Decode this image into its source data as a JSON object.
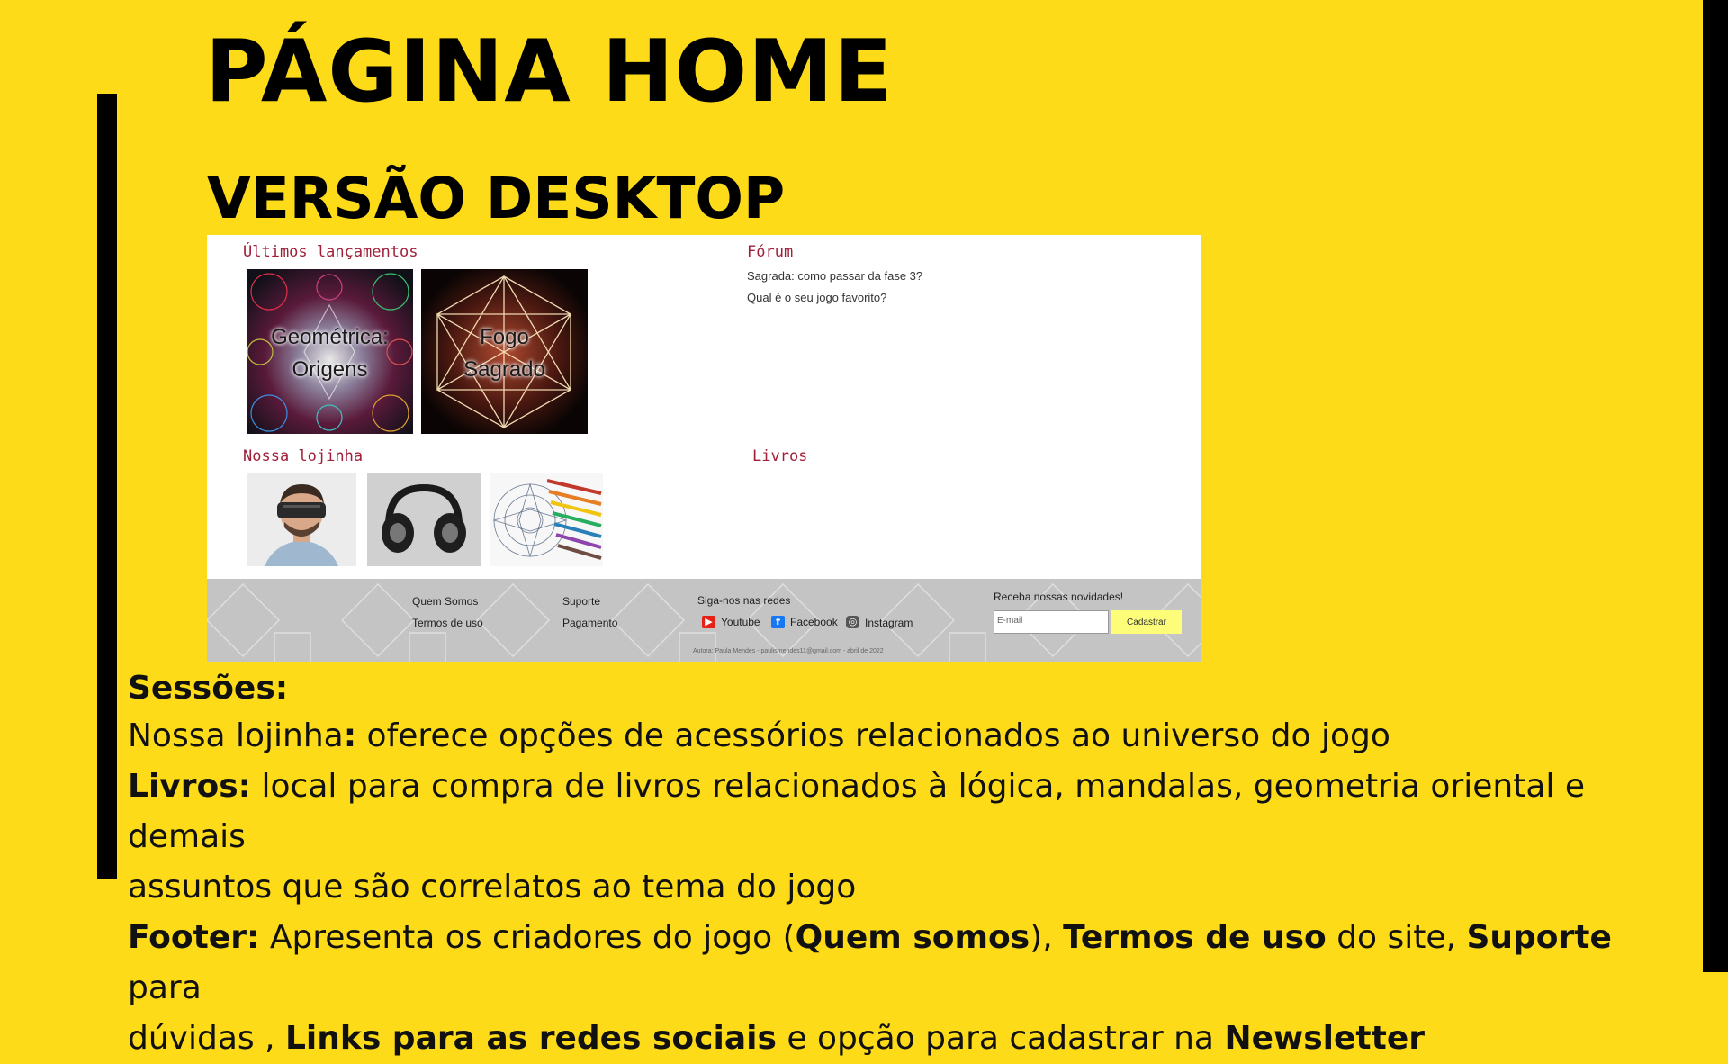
{
  "header": {
    "title": "PÁGINA HOME",
    "subtitle": "VERSÃO DESKTOP"
  },
  "screenshot": {
    "releases": {
      "title": "Últimos lançamentos",
      "games": [
        {
          "name_line1": "Geométrica:",
          "name_line2": "Origens"
        },
        {
          "name_line1": "Fogo",
          "name_line2": "Sagrado"
        }
      ]
    },
    "forum": {
      "title": "Fórum",
      "topics": [
        "Sagrada: como passar da fase 3?",
        "Qual é o seu jogo favorito?"
      ]
    },
    "shop": {
      "title": "Nossa lojinha",
      "products": [
        "vr-headset-photo",
        "headphones-photo",
        "mandala-coloring-photo"
      ]
    },
    "books": {
      "title": "Livros"
    },
    "footer": {
      "links_col1": [
        "Quem Somos",
        "Termos de uso"
      ],
      "links_col2": [
        "Suporte",
        "Pagamento"
      ],
      "social_title": "Siga-nos nas redes",
      "social": [
        "Youtube",
        "Facebook",
        "Instagram"
      ],
      "newsletter_title": "Receba nossas novidades!",
      "email_placeholder": "E-mail",
      "submit_label": "Cadastrar",
      "credit": "Autora: Paula Mendes - paulismendes11@gmail.com - abril de 2022"
    }
  },
  "description": {
    "heading": "Sessões:",
    "shop": {
      "label": "Nossa lojinha",
      "colon": ":",
      "text": " oferece opções de acessórios relacionados ao universo do jogo"
    },
    "books": {
      "label": "Livros:",
      "text": " local para compra de livros relacionados à lógica, mandalas, geometria oriental e demais",
      "text2": "assuntos que são correlatos ao tema do jogo"
    },
    "footer": {
      "label": "Footer:",
      "t1": "  Apresenta os criadores do jogo (",
      "b1": "Quem somos",
      "t2": "), ",
      "b2": "Termos de uso",
      "t3": " do site, ",
      "b3": "Suporte",
      "t4": " para",
      "t5": "dúvidas , ",
      "b4": "Links para as redes sociais",
      "t6": "   e opção para cadastrar na ",
      "b5": "Newsletter"
    }
  },
  "colors": {
    "background": "#fddb19",
    "section_title": "#a0203a",
    "footer_bg": "#c4c4c4",
    "button_bg": "#fdfd7a",
    "youtube": "#e62117",
    "facebook": "#1877f2"
  }
}
